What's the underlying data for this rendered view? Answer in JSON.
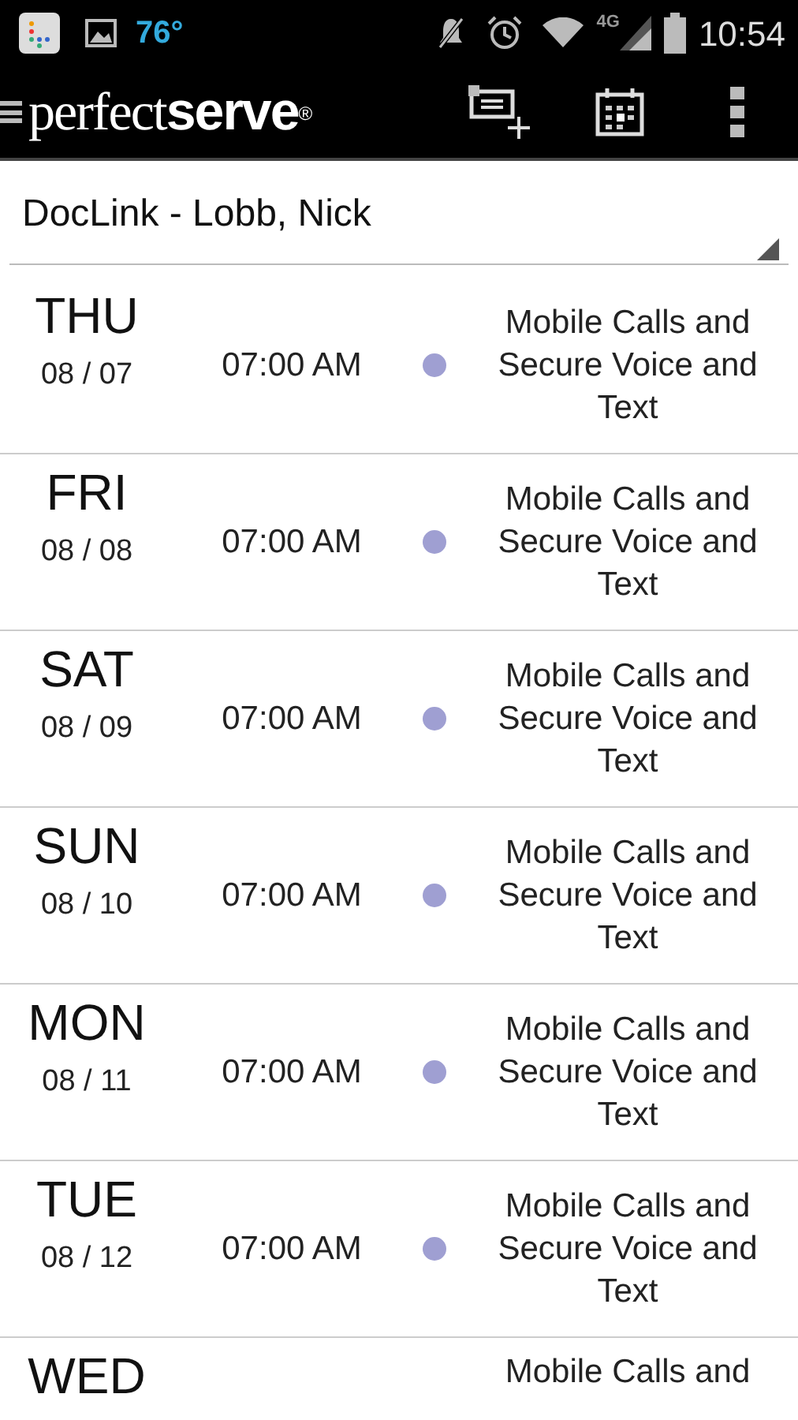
{
  "status_bar": {
    "temperature": "76°",
    "time": "10:54",
    "network": "4G"
  },
  "app_bar": {
    "logo_light": "perfect",
    "logo_bold": "serve",
    "logo_mark": "®"
  },
  "dropdown": {
    "value": "DocLink - Lobb, Nick"
  },
  "schedule": [
    {
      "day": "THU",
      "date": "08 / 07",
      "time": "07:00 AM",
      "color": "#9f9fd2",
      "description": "Mobile Calls and Secure Voice and Text"
    },
    {
      "day": "FRI",
      "date": "08 / 08",
      "time": "07:00 AM",
      "color": "#9f9fd2",
      "description": "Mobile Calls and Secure Voice and Text"
    },
    {
      "day": "SAT",
      "date": "08 / 09",
      "time": "07:00 AM",
      "color": "#9f9fd2",
      "description": "Mobile Calls and Secure Voice and Text"
    },
    {
      "day": "SUN",
      "date": "08 / 10",
      "time": "07:00 AM",
      "color": "#9f9fd2",
      "description": "Mobile Calls and Secure Voice and Text"
    },
    {
      "day": "MON",
      "date": "08 / 11",
      "time": "07:00 AM",
      "color": "#9f9fd2",
      "description": "Mobile Calls and Secure Voice and Text"
    },
    {
      "day": "TUE",
      "date": "08 / 12",
      "time": "07:00 AM",
      "color": "#9f9fd2",
      "description": "Mobile Calls and Secure Voice and Text"
    },
    {
      "day": "WED",
      "description": "Mobile Calls and"
    }
  ]
}
